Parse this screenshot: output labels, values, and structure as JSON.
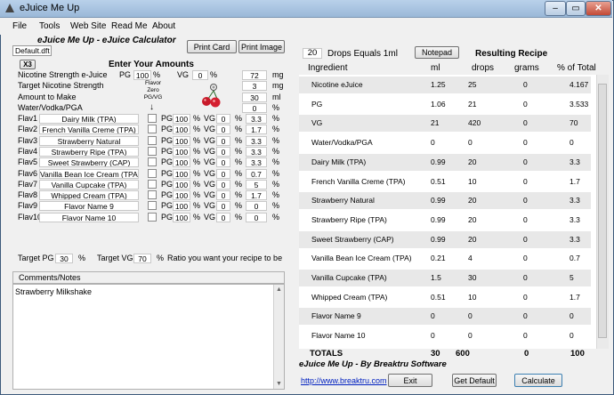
{
  "window": {
    "title": "eJuice Me Up",
    "min_icon": "minimize-icon",
    "max_icon": "maximize-icon",
    "close_icon": "close-icon"
  },
  "menu": [
    "File",
    "Tools",
    "Web Site",
    "Read Me",
    "About"
  ],
  "header": {
    "app_heading": "eJuice Me Up - eJuice Calculator",
    "filename": "Default.dft",
    "print_card": "Print Card",
    "print_image": "Print Image"
  },
  "amounts": {
    "x3": "X3",
    "heading": "Enter Your Amounts",
    "nic_label": "Nicotine Strength e-Juice",
    "nic_pg_label": "PG",
    "nic_pg": "100",
    "pct": "%",
    "nic_vg_label": "VG",
    "nic_vg": "0",
    "nic_strength": "72",
    "mg": "mg",
    "target_label": "Target Nicotine Strength",
    "target_value": "3",
    "amount_label": "Amount to Make",
    "amount_value": "30",
    "ml": "ml",
    "water_label": "Water/Vodka/PGA",
    "water_value": "0",
    "flavor_note": "Flavor Zero PG/VG",
    "down_arrow": "↓"
  },
  "flavors": [
    {
      "id": "Flav1",
      "name": "Dairy Milk (TPA)",
      "pg": "100",
      "vg": "0",
      "pct": "3.3"
    },
    {
      "id": "Flav2",
      "name": "French Vanilla Creme (TPA)",
      "pg": "100",
      "vg": "0",
      "pct": "1.7"
    },
    {
      "id": "Flav3",
      "name": "Strawberry Natural",
      "pg": "100",
      "vg": "0",
      "pct": "3.3"
    },
    {
      "id": "Flav4",
      "name": "Strawberry Ripe (TPA)",
      "pg": "100",
      "vg": "0",
      "pct": "3.3"
    },
    {
      "id": "Flav5",
      "name": "Sweet Strawberry (CAP)",
      "pg": "100",
      "vg": "0",
      "pct": "3.3"
    },
    {
      "id": "Flav6",
      "name": "Vanilla Bean Ice Cream (TPA)",
      "pg": "100",
      "vg": "0",
      "pct": "0.7"
    },
    {
      "id": "Flav7",
      "name": "Vanilla Cupcake (TPA)",
      "pg": "100",
      "vg": "0",
      "pct": "5"
    },
    {
      "id": "Flav8",
      "name": "Whipped Cream (TPA)",
      "pg": "100",
      "vg": "0",
      "pct": "1.7"
    },
    {
      "id": "Flav9",
      "name": "Flavor Name 9",
      "pg": "100",
      "vg": "0",
      "pct": "0"
    },
    {
      "id": "Flav10",
      "name": "Flavor Name 10",
      "pg": "100",
      "vg": "0",
      "pct": "0"
    }
  ],
  "flavor_labels": {
    "pg": "PG",
    "vg": "VG",
    "pct": "%"
  },
  "target_ratio": {
    "pg_label": "Target PG",
    "pg": "30",
    "vg_label": "Target VG",
    "vg": "70",
    "pct": "%",
    "note": "Ratio you want your recipe to be"
  },
  "notes": {
    "label": "Comments/Notes",
    "text": "Strawberry Milkshake"
  },
  "drops": {
    "value": "20",
    "label": "Drops Equals 1ml",
    "notepad": "Notepad"
  },
  "recipe": {
    "heading": "Resulting Recipe",
    "headers": [
      "Ingredient",
      "ml",
      "drops",
      "grams",
      "% of Total"
    ],
    "rows": [
      [
        "Nicotine eJuice",
        "1.25",
        "25",
        "0",
        "4.167"
      ],
      [
        "PG",
        "1.06",
        "21",
        "0",
        "3.533"
      ],
      [
        "VG",
        "21",
        "420",
        "0",
        "70"
      ],
      [
        "Water/Vodka/PGA",
        "0",
        "0",
        "0",
        "0"
      ],
      [
        "Dairy Milk (TPA)",
        "0.99",
        "20",
        "0",
        "3.3"
      ],
      [
        "French Vanilla Creme (TPA)",
        "0.51",
        "10",
        "0",
        "1.7"
      ],
      [
        "Strawberry Natural",
        "0.99",
        "20",
        "0",
        "3.3"
      ],
      [
        "Strawberry Ripe (TPA)",
        "0.99",
        "20",
        "0",
        "3.3"
      ],
      [
        "Sweet Strawberry (CAP)",
        "0.99",
        "20",
        "0",
        "3.3"
      ],
      [
        "Vanilla Bean Ice Cream (TPA)",
        "0.21",
        "4",
        "0",
        "0.7"
      ],
      [
        "Vanilla Cupcake (TPA)",
        "1.5",
        "30",
        "0",
        "5"
      ],
      [
        "Whipped Cream (TPA)",
        "0.51",
        "10",
        "0",
        "1.7"
      ],
      [
        "Flavor Name 9",
        "0",
        "0",
        "0",
        "0"
      ],
      [
        "Flavor Name 10",
        "0",
        "0",
        "0",
        "0"
      ]
    ],
    "totals": [
      "TOTALS",
      "30",
      "600",
      "0",
      "100"
    ]
  },
  "footer": {
    "credit": "eJuice Me Up - By Breaktru Software",
    "url": "http://www.breaktru.com",
    "exit": "Exit",
    "get_default": "Get Default",
    "calculate": "Calculate"
  }
}
